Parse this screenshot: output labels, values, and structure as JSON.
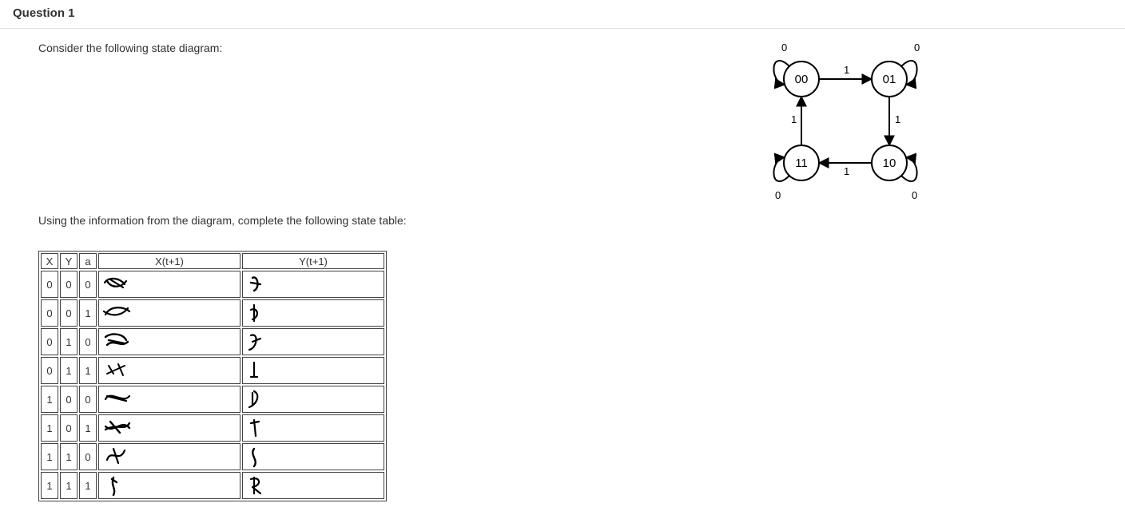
{
  "question_heading": "Question 1",
  "prompt": "Consider the following state diagram:",
  "subprompt": "Using the information from the diagram, complete the following state table:",
  "diagram": {
    "states": [
      "00",
      "01",
      "11",
      "10"
    ],
    "transitions": [
      {
        "from": "00",
        "to": "00",
        "label": "0"
      },
      {
        "from": "00",
        "to": "01",
        "label": "1"
      },
      {
        "from": "01",
        "to": "01",
        "label": "0"
      },
      {
        "from": "01",
        "to": "10",
        "label": "1"
      },
      {
        "from": "10",
        "to": "10",
        "label": "0"
      },
      {
        "from": "10",
        "to": "11",
        "label": "1"
      },
      {
        "from": "11",
        "to": "11",
        "label": "0"
      },
      {
        "from": "11",
        "to": "00",
        "label": "1"
      }
    ]
  },
  "table": {
    "headers": {
      "x": "X",
      "y": "Y",
      "a": "a",
      "xt": "X(t+1)",
      "yt": "Y(t+1)"
    },
    "rows": [
      {
        "x": "0",
        "y": "0",
        "a": "0"
      },
      {
        "x": "0",
        "y": "0",
        "a": "1"
      },
      {
        "x": "0",
        "y": "1",
        "a": "0"
      },
      {
        "x": "0",
        "y": "1",
        "a": "1"
      },
      {
        "x": "1",
        "y": "0",
        "a": "0"
      },
      {
        "x": "1",
        "y": "0",
        "a": "1"
      },
      {
        "x": "1",
        "y": "1",
        "a": "0"
      },
      {
        "x": "1",
        "y": "1",
        "a": "1"
      }
    ]
  }
}
